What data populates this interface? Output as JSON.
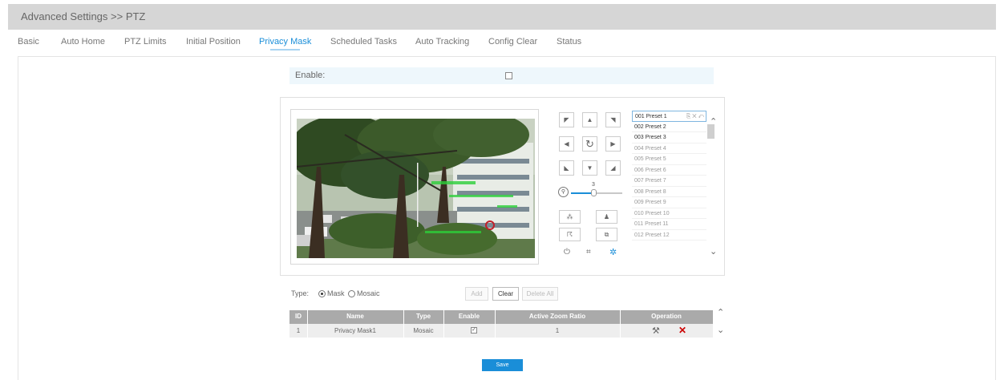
{
  "header": {
    "title": "Advanced Settings >> PTZ"
  },
  "tabs": [
    {
      "label": "Basic"
    },
    {
      "label": "Auto Home"
    },
    {
      "label": "PTZ Limits"
    },
    {
      "label": "Initial Position"
    },
    {
      "label": "Privacy Mask",
      "active": true
    },
    {
      "label": "Scheduled Tasks"
    },
    {
      "label": "Auto Tracking"
    },
    {
      "label": "Config Clear"
    },
    {
      "label": "Status"
    }
  ],
  "enable": {
    "label": "Enable:",
    "checked": false
  },
  "ptz": {
    "speed_value": "3",
    "presets": [
      "001 Preset 1",
      "002 Preset 2",
      "003 Preset 3",
      "004 Preset 4",
      "005 Preset 5",
      "006 Preset 6",
      "007 Preset 7",
      "008 Preset 8",
      "009 Preset 9",
      "010 Preset 10",
      "011 Preset 11",
      "012 Preset 12"
    ],
    "selected_preset": 0,
    "defined_presets": 3
  },
  "type": {
    "label": "Type:",
    "options": [
      "Mask",
      "Mosaic"
    ],
    "selected": "Mask"
  },
  "actions": {
    "add": "Add",
    "clear": "Clear",
    "delete_all": "Delete All"
  },
  "table": {
    "headers": [
      "ID",
      "Name",
      "Type",
      "Enable",
      "Active Zoom Ratio",
      "Operation"
    ],
    "rows": [
      {
        "id": "1",
        "name": "Privacy Mask1",
        "type": "Mosaic",
        "enabled": true,
        "zoom": "1"
      }
    ]
  },
  "save_label": "Save",
  "colors": {
    "accent": "#1a8ed8",
    "header_bg": "#d6d6d6",
    "table_header": "#aaaaaa",
    "delete_red": "#cc0000"
  }
}
